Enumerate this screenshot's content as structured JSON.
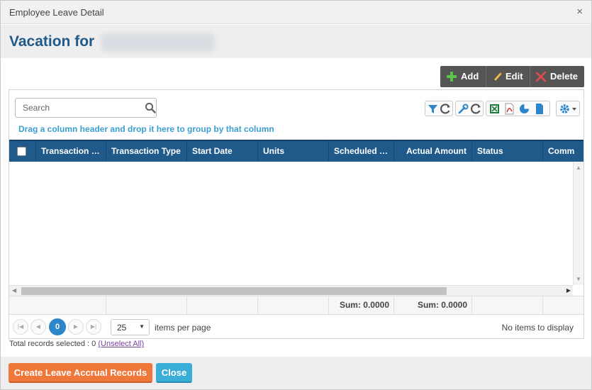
{
  "dialog": {
    "title": "Employee Leave Detail",
    "close_glyph": "×"
  },
  "header": {
    "heading": "Vacation for"
  },
  "actions": {
    "add": "Add",
    "edit": "Edit",
    "delete": "Delete"
  },
  "search": {
    "placeholder": "Search"
  },
  "toolbar_icons": [
    "filter-icon",
    "refresh-icon",
    "wrench-icon",
    "reset-icon",
    "excel-icon",
    "pdf-icon",
    "chart-icon",
    "document-icon",
    "settings-gear-icon"
  ],
  "grid": {
    "group_hint": "Drag a column header and drop it here to group by that column",
    "columns": [
      "Transaction …",
      "Transaction Type",
      "Start Date",
      "Units",
      "Scheduled …",
      "Actual Amount",
      "Status",
      "Comm"
    ],
    "footer": {
      "scheduled_sum": "Sum: 0.0000",
      "actual_sum": "Sum: 0.0000"
    }
  },
  "pager": {
    "current_page": "0",
    "page_size": "25",
    "items_per_page": "items per page",
    "no_items": "No items to display"
  },
  "selection": {
    "summary": "Total records selected : 0",
    "unselect_link": "(Unselect All)"
  },
  "buttons": {
    "create": "Create Leave Accrual Records",
    "close": "Close"
  },
  "colors": {
    "header_blue": "#1f5a8b",
    "accent_orange": "#f0773a",
    "accent_cyan": "#3aaed6",
    "hint_blue": "#3a9ecf",
    "page_active": "#2d86c9"
  }
}
